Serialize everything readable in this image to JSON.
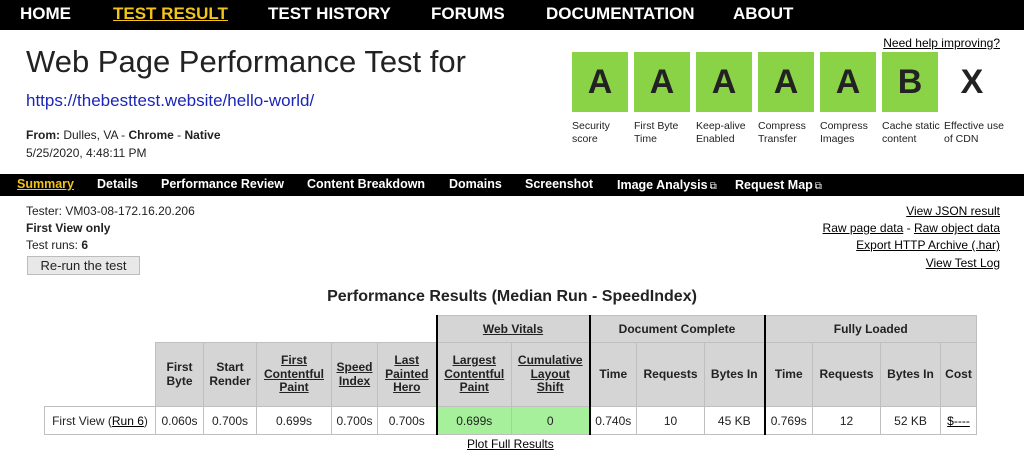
{
  "topnav": {
    "items": [
      "HOME",
      "TEST RESULT",
      "TEST HISTORY",
      "FORUMS",
      "DOCUMENTATION",
      "ABOUT"
    ],
    "active": "TEST RESULT"
  },
  "header": {
    "title": "Web Page Performance Test for",
    "url": "https://thebesttest.website/hello-world/",
    "from_prefix": "From:",
    "location": " Dulles, VA - ",
    "browser": "Chrome",
    "sep": " - ",
    "connectivity": "Native",
    "date": "5/25/2020, 4:48:11 PM",
    "help_link": "Need help improving?"
  },
  "grades": [
    {
      "grade": "A",
      "label": "Security score",
      "color": "#8bd346"
    },
    {
      "grade": "A",
      "label": "First Byte Time",
      "color": "#8bd346"
    },
    {
      "grade": "A",
      "label": "Keep-alive Enabled",
      "color": "#8bd346"
    },
    {
      "grade": "A",
      "label": "Compress Transfer",
      "color": "#8bd346"
    },
    {
      "grade": "A",
      "label": "Compress Images",
      "color": "#8bd346"
    },
    {
      "grade": "B",
      "label": "Cache static content",
      "color": "#8bd346"
    },
    {
      "grade": "X",
      "label": "Effective use of CDN",
      "color": "transparent"
    }
  ],
  "subnav": {
    "items": [
      "Summary",
      "Details",
      "Performance Review",
      "Content Breakdown",
      "Domains",
      "Screenshot",
      "Image Analysis",
      "Request Map"
    ],
    "active": "Summary",
    "external_icon": "external-link-icon"
  },
  "tester": {
    "tester_line": "Tester: VM03-08-172.16.20.206",
    "view_line": "First View only",
    "runs_prefix": "Test runs: ",
    "runs": "6",
    "rerun_label": "Re-run the test"
  },
  "raw_links": {
    "json": "View JSON result",
    "raw_page": "Raw page data",
    "dash": " - ",
    "raw_object": "Raw object data",
    "har": "Export HTTP Archive (.har)",
    "log": "View Test Log"
  },
  "results": {
    "title": "Performance Results (Median Run - SpeedIndex)",
    "groups": {
      "web_vitals": "Web Vitals",
      "document_complete": "Document Complete",
      "fully_loaded": "Fully Loaded"
    },
    "columns": {
      "first_byte": "First Byte",
      "start_render": "Start Render",
      "fcp": "First Contentful Paint",
      "speed_index": "Speed Index",
      "last_painted_hero": "Last Painted Hero",
      "lcp": "Largest Contentful Paint",
      "cls": "Cumulative Layout Shift",
      "time": "Time",
      "requests": "Requests",
      "bytes_in": "Bytes In",
      "cost": "Cost"
    },
    "row": {
      "label": "First View (",
      "run_link": "Run 6",
      "label_end": ")",
      "first_byte": "0.060s",
      "start_render": "0.700s",
      "fcp": "0.699s",
      "speed_index": "0.700s",
      "last_painted_hero": "0.700s",
      "lcp": "0.699s",
      "cls": "0",
      "doc_time": "0.740s",
      "doc_requests": "10",
      "doc_bytes": "45 KB",
      "full_time": "0.769s",
      "full_requests": "12",
      "full_bytes": "52 KB",
      "cost": "$----"
    },
    "vitals_color": "#a6f09c",
    "plot_link": "Plot Full Results"
  }
}
